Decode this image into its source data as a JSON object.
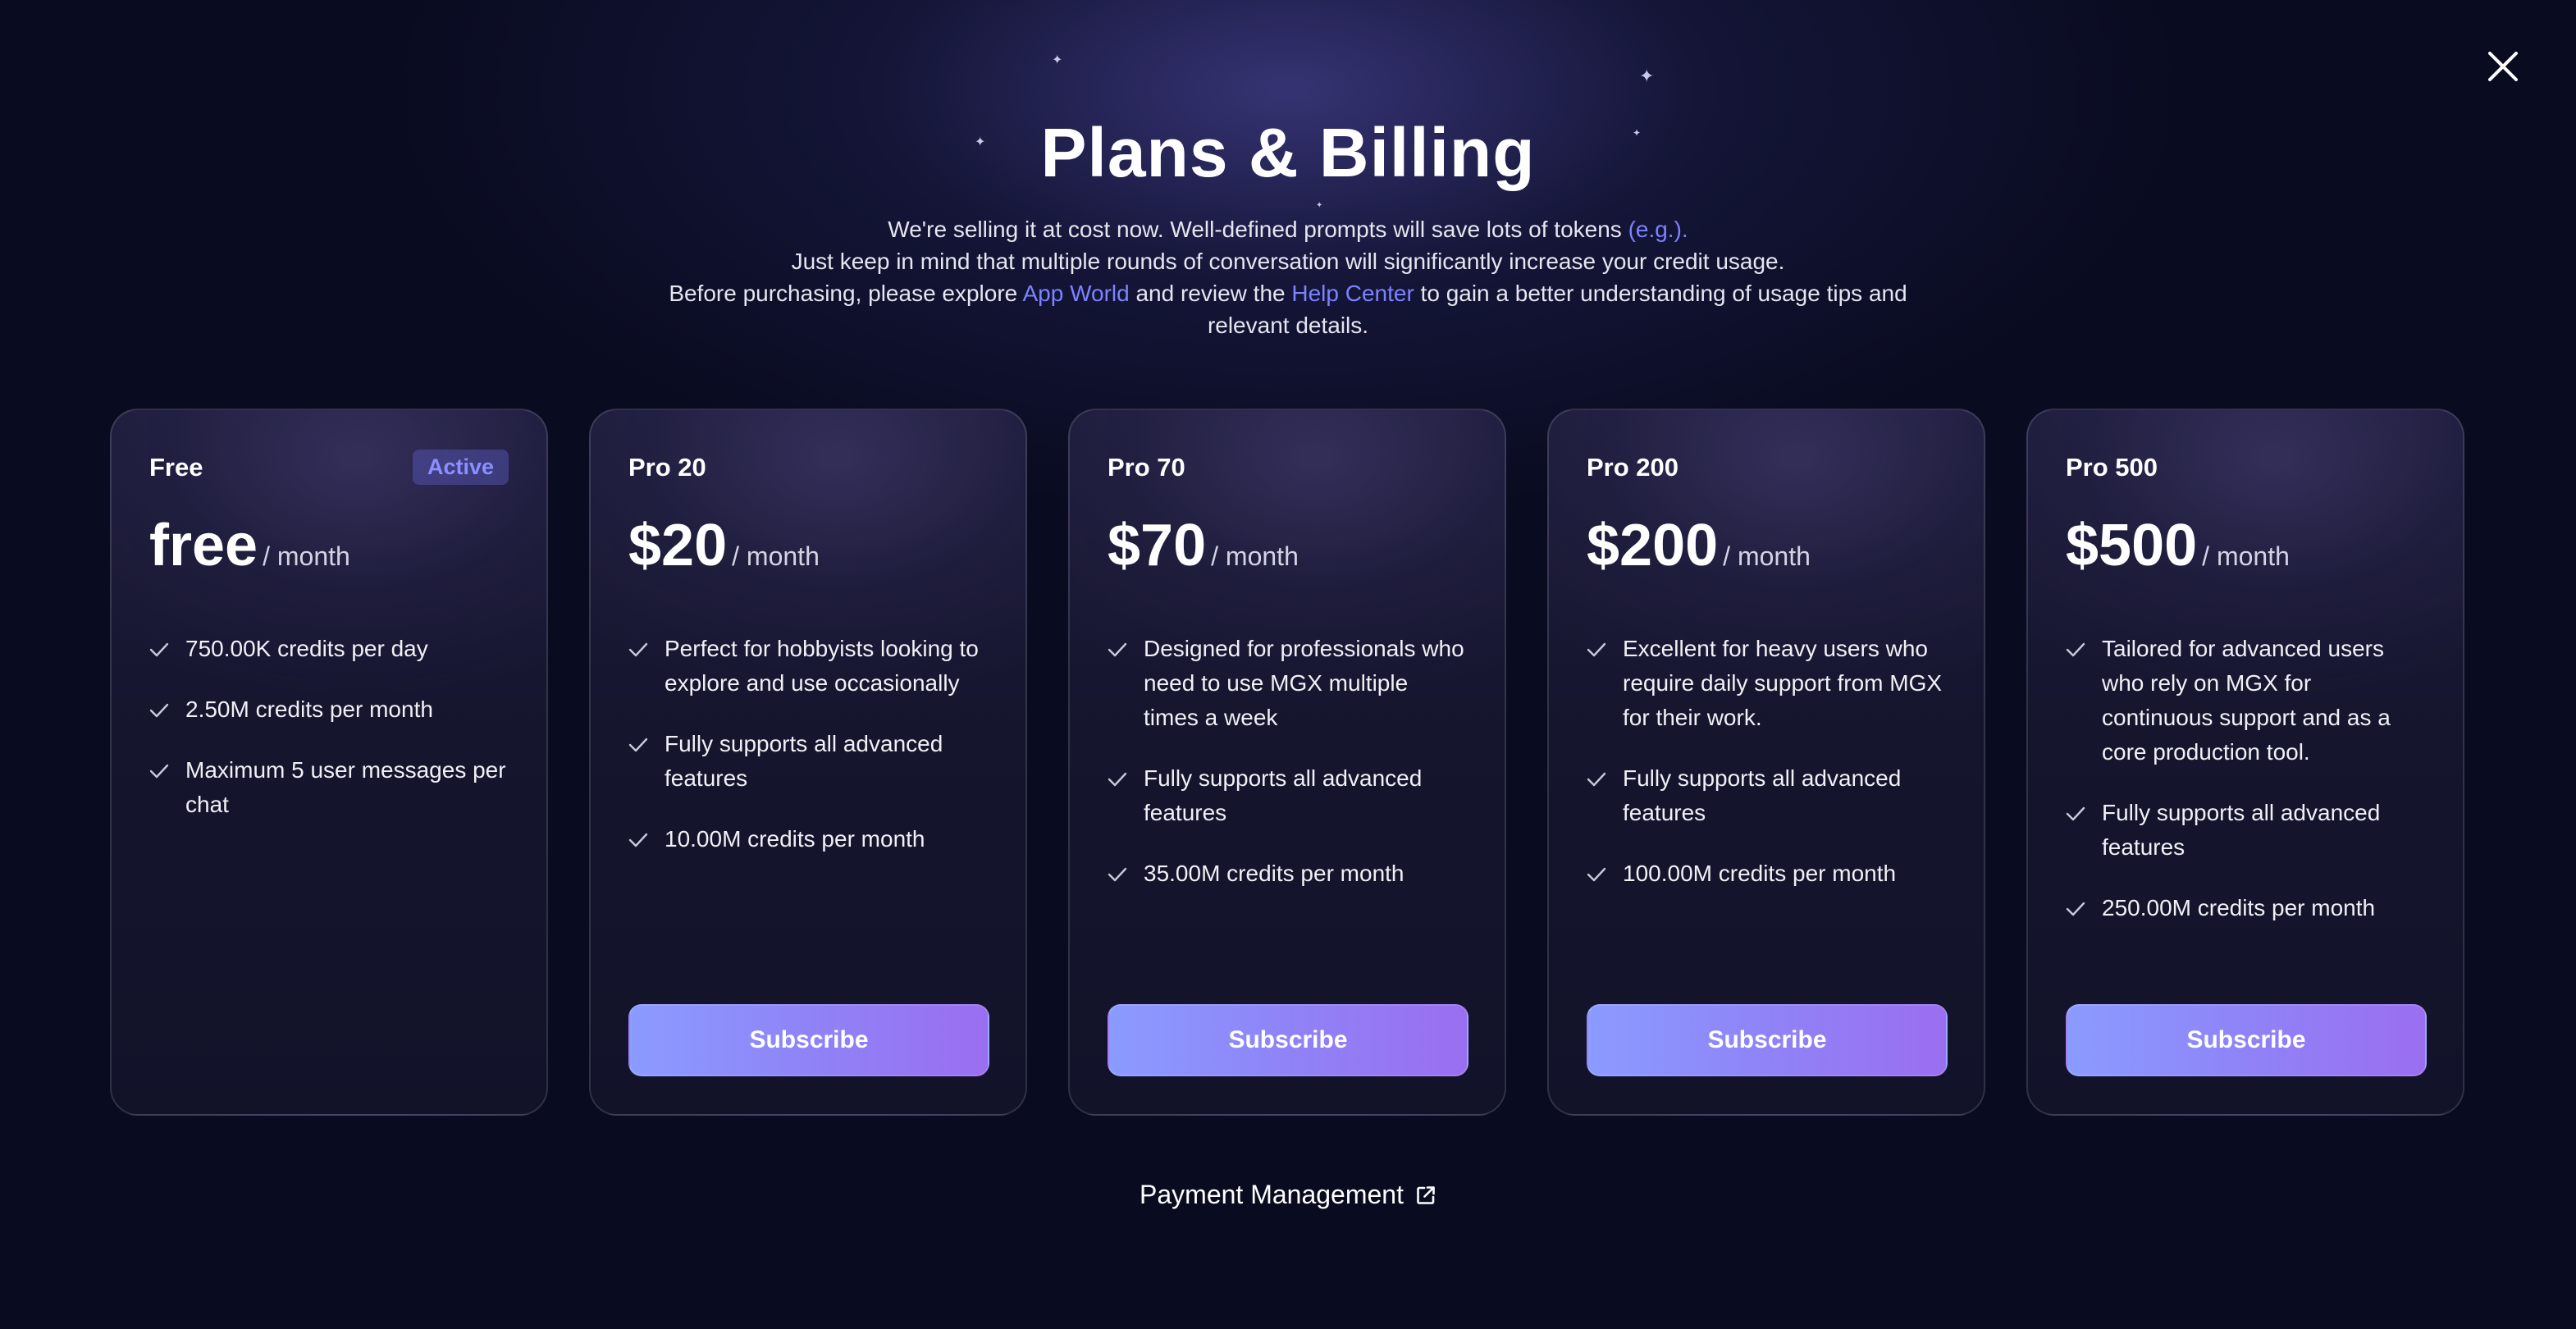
{
  "header": {
    "title": "Plans & Billing",
    "subtitle": {
      "line1_text": "We're selling it at cost now. Well-defined prompts will save lots of tokens ",
      "line1_link": "(e.g.).",
      "line2": "Just keep in mind that multiple rounds of conversation will significantly increase your credit usage.",
      "line3_pre": "Before purchasing, please explore ",
      "line3_link1": "App World",
      "line3_mid": " and review the ",
      "line3_link2": "Help Center",
      "line3_post": " to gain a better understanding of usage tips and",
      "line4": "relevant details."
    }
  },
  "colors": {
    "background": "#090b20",
    "accent_link": "#7b83ff",
    "button_gradient_start": "#8b9bff",
    "button_gradient_end": "#9a6ef0",
    "active_badge_text": "#8b8fff"
  },
  "icons": {
    "close": "close-icon",
    "check": "check-icon",
    "external": "external-link-icon",
    "sparkle": "sparkle-icon"
  },
  "plans": [
    {
      "name": "Free",
      "badge": "Active",
      "price": "free",
      "period": "/ month",
      "features": [
        "750.00K credits per day",
        "2.50M credits per month",
        "Maximum 5 user messages per chat"
      ]
    },
    {
      "name": "Pro 20",
      "price": "$20",
      "period": "/ month",
      "features": [
        "Perfect for hobbyists looking to explore and use occasionally",
        "Fully supports all advanced features",
        "10.00M credits per month"
      ],
      "button": "Subscribe"
    },
    {
      "name": "Pro 70",
      "price": "$70",
      "period": "/ month",
      "features": [
        "Designed for professionals who need to use MGX multiple times a week",
        "Fully supports all advanced features",
        "35.00M credits per month"
      ],
      "button": "Subscribe"
    },
    {
      "name": "Pro 200",
      "price": "$200",
      "period": "/ month",
      "features": [
        "Excellent for heavy users who require daily support from MGX for their work.",
        "Fully supports all advanced features",
        "100.00M credits per month"
      ],
      "button": "Subscribe"
    },
    {
      "name": "Pro 500",
      "price": "$500",
      "period": "/ month",
      "features": [
        "Tailored for advanced users who rely on MGX for continuous support and as a core production tool.",
        "Fully supports all advanced features",
        "250.00M credits per month"
      ],
      "button": "Subscribe"
    }
  ],
  "footer": {
    "payment_management": "Payment Management"
  }
}
